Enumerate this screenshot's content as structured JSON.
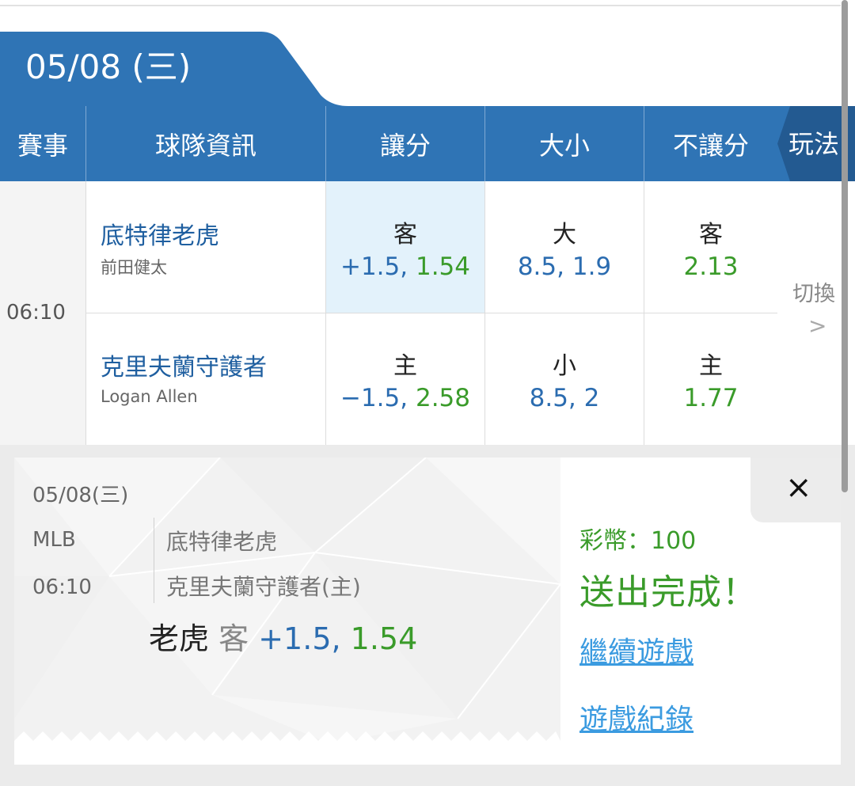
{
  "date_tab": "05/08 (三)",
  "headers": {
    "event": "賽事",
    "team_info": "球隊資訊",
    "handicap": "讓分",
    "over_under": "大小",
    "moneyline": "不讓分",
    "play": "玩法"
  },
  "game": {
    "time": "06:10",
    "away": {
      "team": "底特律老虎",
      "pitcher": "前田健太",
      "handicap_label": "客",
      "handicap_line": "+1.5,",
      "handicap_odds": "1.54",
      "ou_label": "大",
      "ou_line": "8.5,",
      "ou_odds": "1.9",
      "ml_label": "客",
      "ml_odds": "2.13"
    },
    "home": {
      "team": "克里夫蘭守護者",
      "pitcher": "Logan Allen",
      "handicap_label": "主",
      "handicap_line": "−1.5,",
      "handicap_odds": "2.58",
      "ou_label": "小",
      "ou_line": "8.5,",
      "ou_odds": "2",
      "ml_label": "主",
      "ml_odds": "1.77"
    },
    "switch_label": "切換",
    "switch_arrow": ">"
  },
  "ticket": {
    "date": "05/08(三)",
    "league": "MLB",
    "time": "06:10",
    "team1": "底特律老虎",
    "team2": "克里夫蘭守護者(主)",
    "bet_team": "老虎",
    "bet_side": "客",
    "bet_line": "+1.5,",
    "bet_odds": "1.54"
  },
  "result": {
    "coins": "彩幣：100",
    "message": "送出完成！",
    "continue_link": "繼續遊戲",
    "history_link": "遊戲紀錄",
    "close": "×"
  },
  "colors": {
    "primary_blue": "#2f74b5",
    "dark_blue": "#235a91",
    "odds_green": "#3a9b2a",
    "odds_blue": "#2b6cb0",
    "link_blue": "#3b9be0",
    "highlight": "#e3f2fb"
  }
}
